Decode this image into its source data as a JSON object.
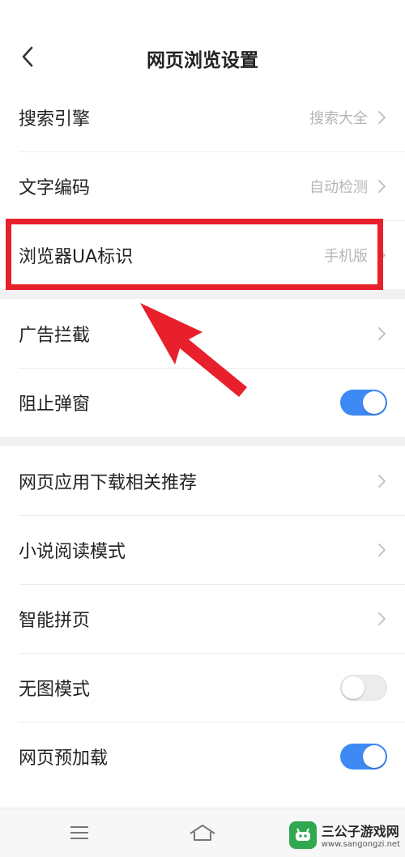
{
  "header": {
    "title": "网页浏览设置"
  },
  "groups": [
    {
      "items": [
        {
          "label": "搜索引擎",
          "value": "搜索大全"
        },
        {
          "label": "文字编码",
          "value": "自动检测"
        },
        {
          "label": "浏览器UA标识",
          "value": "手机版"
        }
      ]
    },
    {
      "items": [
        {
          "label": "广告拦截"
        },
        {
          "label": "阻止弹窗",
          "toggle": true
        }
      ]
    },
    {
      "items": [
        {
          "label": "网页应用下载相关推荐"
        },
        {
          "label": "小说阅读模式"
        },
        {
          "label": "智能拼页"
        },
        {
          "label": "无图模式",
          "toggle": false
        },
        {
          "label": "网页预加载",
          "toggle": true
        }
      ]
    }
  ],
  "icons": {
    "back": "chevron-left-icon",
    "chevron": "chevron-right-icon",
    "menu": "menu-icon",
    "home": "home-icon"
  },
  "colors": {
    "accent": "#3d8af5",
    "highlight": "#e8202b",
    "divider": "#f1f1f1"
  },
  "watermark": {
    "title": "三公子游戏网",
    "url": "www.sangongzi.net"
  }
}
